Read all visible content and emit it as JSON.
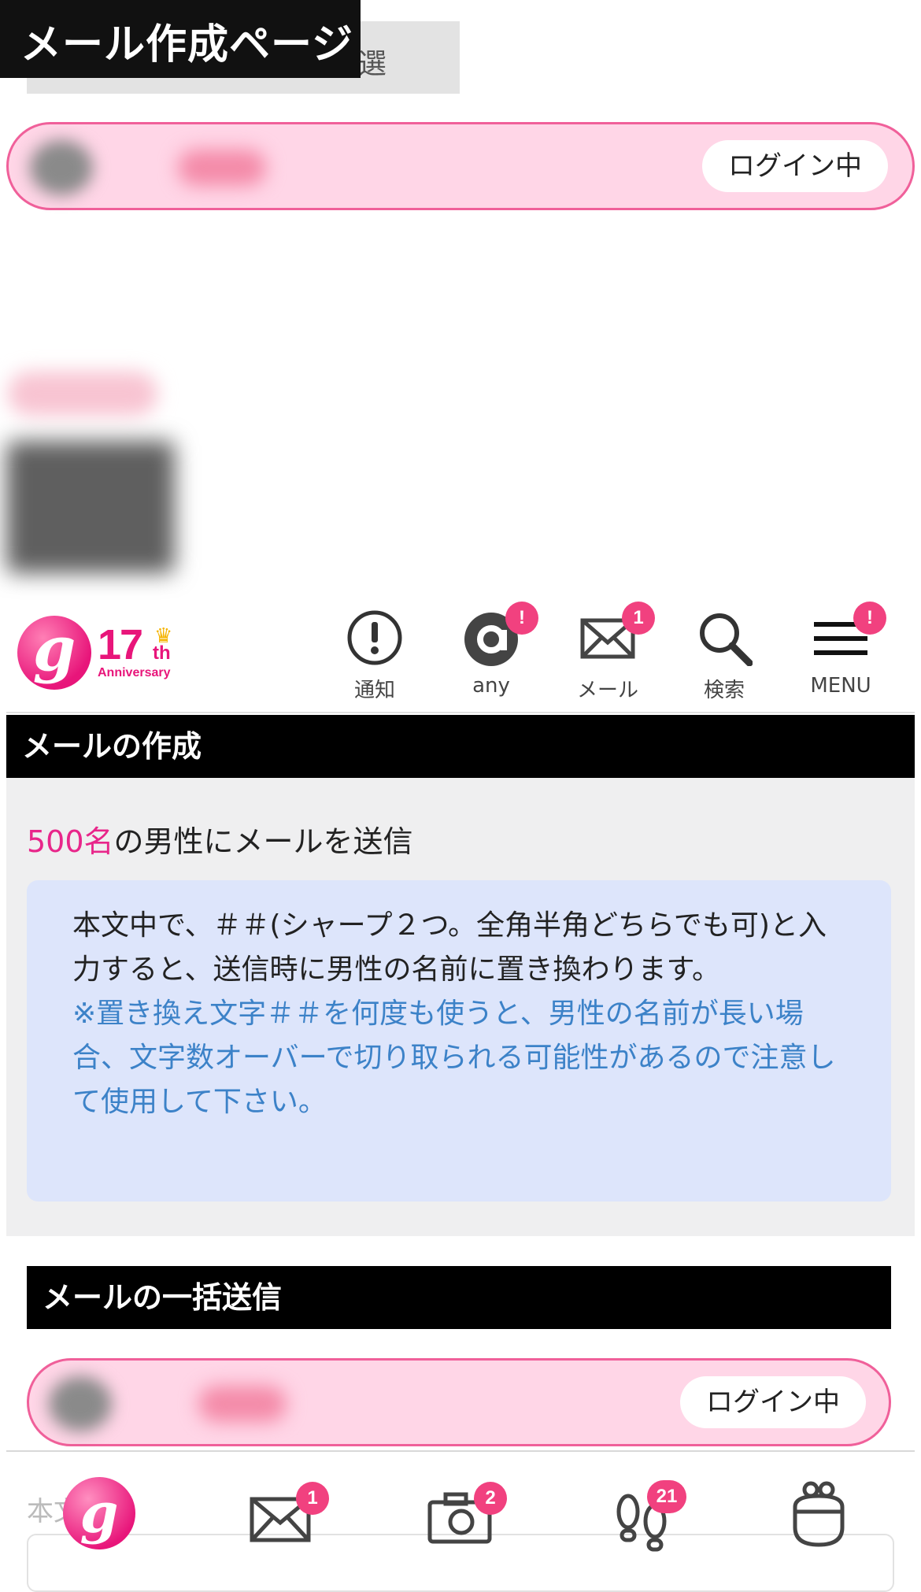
{
  "caption": {
    "title": "メール作成ページ"
  },
  "partial_tab": {
    "text": "選"
  },
  "user_bar": {
    "status": "ログイン中"
  },
  "logo": {
    "number": "17",
    "suffix": "th",
    "label": "Anniversary"
  },
  "nav": {
    "items": [
      {
        "label": "通知",
        "icon": "notification-icon",
        "badge": ""
      },
      {
        "label": "any",
        "icon": "at-icon",
        "badge": "!"
      },
      {
        "label": "メール",
        "icon": "mail-icon",
        "badge": "1"
      },
      {
        "label": "検索",
        "icon": "search-icon",
        "badge": ""
      },
      {
        "label": "MENU",
        "icon": "menu-icon",
        "badge": "!"
      }
    ]
  },
  "compose": {
    "header": "メールの作成",
    "recipient_count": "500名",
    "recipient_text": "の男性にメールを送信",
    "info_text": "本文中で、＃＃(シャープ２つ。全角半角どちらでも可)と入力すると、送信時に男性の名前に置き換わります。",
    "info_note": "※置き換え文字＃＃を何度も使うと、男性の名前が長い場合、文字数オーバーで切り取られる可能性があるので注意して使用して下さい。"
  },
  "bulk": {
    "header": "メールの一括送信",
    "status": "ログイン中",
    "body_label": "本文"
  },
  "tabbar": {
    "items": [
      {
        "icon": "home-logo-icon",
        "badge": ""
      },
      {
        "icon": "mail-icon",
        "badge": "1"
      },
      {
        "icon": "camera-icon",
        "badge": "2"
      },
      {
        "icon": "footprints-icon",
        "badge": "21"
      },
      {
        "icon": "purse-icon",
        "badge": ""
      }
    ]
  },
  "colors": {
    "accent_pink": "#e8268a",
    "pill_bg": "#ffd6e7",
    "badge": "#f1417f",
    "note_blue": "#3c82c8",
    "info_bg": "#dde5fb"
  }
}
